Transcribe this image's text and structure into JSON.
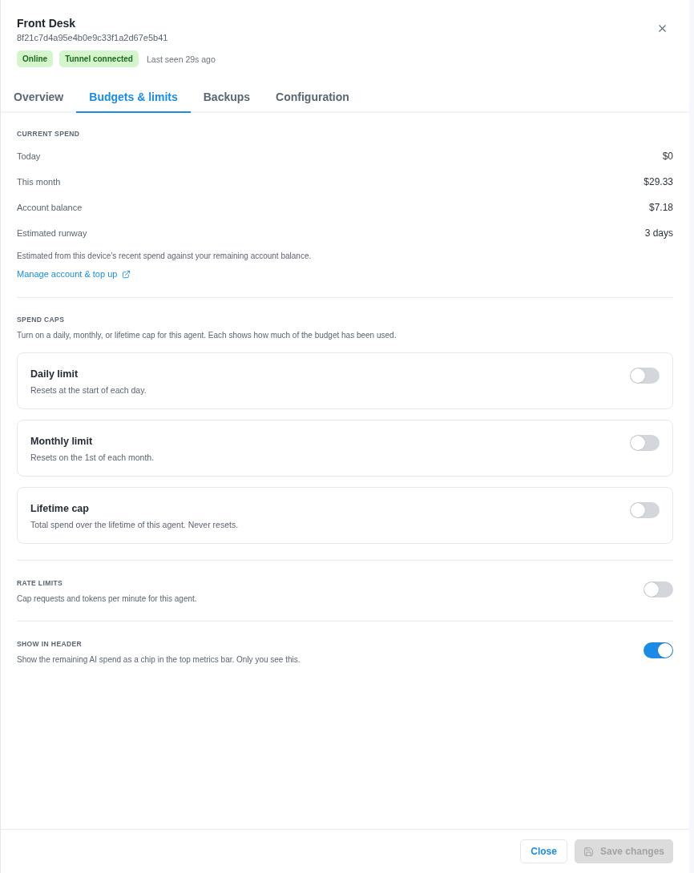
{
  "panel": {
    "title": "Front Desk",
    "device_id": "8f21c7d4a95e4b0e9c33f1a2d67e5b41",
    "badges": [
      {
        "label": "Online"
      },
      {
        "label": "Tunnel connected"
      }
    ],
    "last_seen": "Last seen 29s ago"
  },
  "tabs": [
    {
      "label": "Overview",
      "selected": false
    },
    {
      "label": "Budgets & limits",
      "selected": true
    },
    {
      "label": "Backups",
      "selected": false
    },
    {
      "label": "Configuration",
      "selected": false
    }
  ],
  "current_spend": {
    "heading": "CURRENT SPEND",
    "rows": [
      {
        "label": "Today",
        "value": "$0"
      },
      {
        "label": "This month",
        "value": "$29.33"
      },
      {
        "label": "Account balance",
        "value": "$7.18"
      },
      {
        "label": "Estimated runway",
        "value": "3 days"
      }
    ],
    "note": "Estimated from this device’s recent spend against your remaining account balance.",
    "link": "Manage account & top up"
  },
  "spend_caps": {
    "heading": "SPEND CAPS",
    "description": "Turn on a daily, monthly, or lifetime cap for this agent. Each shows how much of the budget has been used.",
    "caps": [
      {
        "title": "Daily limit",
        "description": "Resets at the start of each day.",
        "on": false
      },
      {
        "title": "Monthly limit",
        "description": "Resets on the 1st of each month.",
        "on": false
      },
      {
        "title": "Lifetime cap",
        "description": "Total spend over the lifetime of this agent. Never resets.",
        "on": false
      }
    ]
  },
  "settings": [
    {
      "heading": "RATE LIMITS",
      "description": "Cap requests and tokens per minute for this agent.",
      "on": false
    },
    {
      "heading": "SHOW IN HEADER",
      "description": "Show the remaining AI spend as a chip in the top metrics bar. Only you see this.",
      "on": true
    }
  ],
  "footer": {
    "buttons": [
      {
        "label": "Close",
        "kind": "outline",
        "disabled": false
      },
      {
        "label": "Save changes",
        "kind": "save",
        "disabled": true
      }
    ]
  }
}
